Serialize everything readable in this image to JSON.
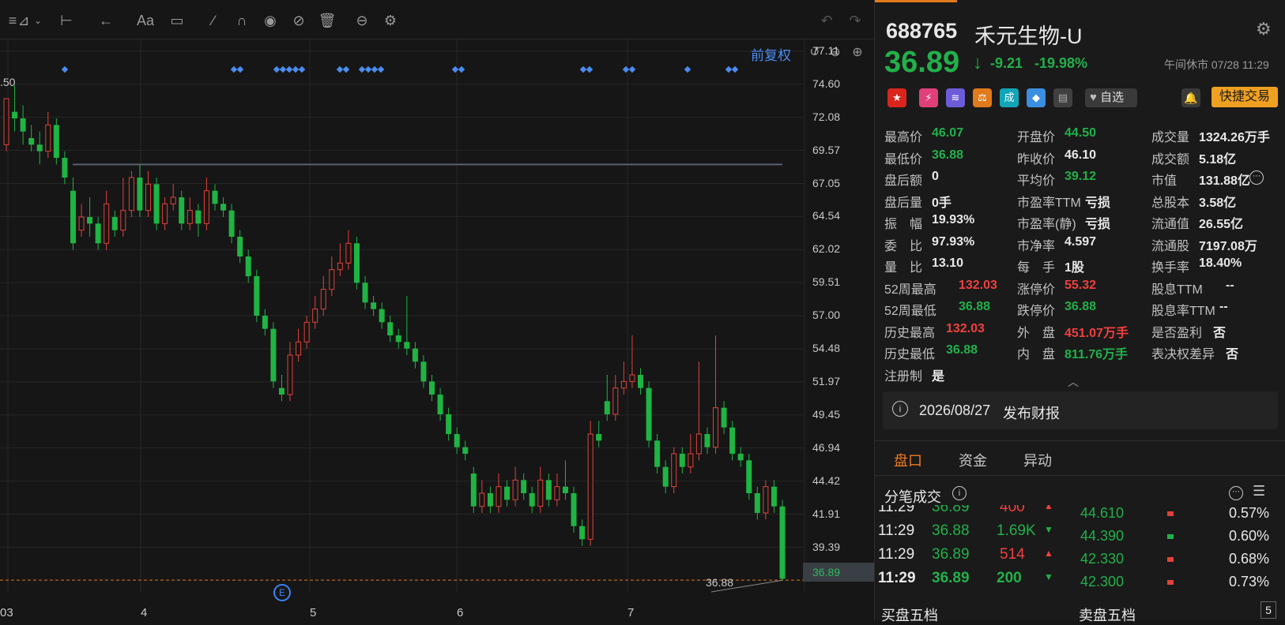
{
  "chart": {
    "adjust_label": "前复权",
    "top_left_partial": ".50",
    "y_labels": [
      "77.11",
      "74.60",
      "72.08",
      "69.57",
      "67.05",
      "64.54",
      "62.02",
      "59.51",
      "57.00",
      "54.48",
      "51.97",
      "49.45",
      "46.94",
      "44.42",
      "41.91",
      "39.39"
    ],
    "current_price_label": "36.89",
    "min_label": "36.88",
    "x_labels": [
      "03",
      "4",
      "5",
      "6",
      "7"
    ],
    "event_badge": "E"
  },
  "chart_data": {
    "type": "candlestick",
    "ylim": [
      36.0,
      78.0
    ],
    "reference_line": 68.5,
    "current_price": 36.89,
    "x_labels": [
      "03",
      "4",
      "5",
      "6",
      "7"
    ],
    "candles": [
      [
        70.0,
        73.5,
        70.5,
        69.5,
        "up"
      ],
      [
        72.5,
        72.0,
        74.5,
        71.0,
        "down"
      ],
      [
        72.0,
        71.0,
        73.0,
        70.0,
        "down"
      ],
      [
        70.5,
        70.0,
        71.5,
        69.5,
        "down"
      ],
      [
        70.0,
        69.5,
        71.0,
        68.5,
        "down"
      ],
      [
        69.5,
        71.5,
        72.5,
        69.0,
        "up"
      ],
      [
        71.5,
        69.0,
        72.0,
        68.5,
        "down"
      ],
      [
        69.0,
        67.5,
        69.5,
        67.0,
        "down"
      ],
      [
        66.5,
        62.5,
        67.5,
        62.0,
        "down"
      ],
      [
        63.5,
        64.5,
        65.5,
        63.0,
        "up"
      ],
      [
        64.5,
        64.0,
        66.0,
        63.0,
        "down"
      ],
      [
        64.0,
        62.5,
        64.5,
        62.0,
        "down"
      ],
      [
        62.5,
        65.5,
        66.5,
        62.0,
        "up"
      ],
      [
        64.5,
        63.5,
        65.0,
        63.0,
        "down"
      ],
      [
        63.5,
        65.0,
        67.5,
        63.0,
        "up"
      ],
      [
        65.0,
        67.5,
        68.0,
        64.5,
        "up"
      ],
      [
        67.5,
        65.0,
        68.5,
        64.5,
        "down"
      ],
      [
        65.0,
        67.0,
        68.0,
        64.5,
        "up"
      ],
      [
        67.0,
        64.0,
        67.5,
        63.5,
        "down"
      ],
      [
        64.0,
        65.5,
        66.0,
        63.5,
        "up"
      ],
      [
        65.5,
        66.0,
        67.0,
        65.0,
        "up"
      ],
      [
        66.0,
        64.0,
        66.5,
        63.5,
        "down"
      ],
      [
        64.0,
        65.0,
        66.0,
        63.5,
        "up"
      ],
      [
        65.0,
        64.0,
        65.5,
        63.0,
        "down"
      ],
      [
        64.0,
        66.5,
        67.5,
        63.5,
        "up"
      ],
      [
        66.5,
        65.5,
        67.0,
        65.0,
        "down"
      ],
      [
        65.5,
        65.0,
        66.0,
        64.5,
        "down"
      ],
      [
        65.0,
        63.0,
        65.5,
        62.5,
        "down"
      ],
      [
        63.0,
        61.5,
        63.5,
        61.0,
        "down"
      ],
      [
        61.5,
        60.0,
        62.0,
        59.5,
        "down"
      ],
      [
        60.0,
        57.0,
        60.5,
        56.5,
        "down"
      ],
      [
        57.0,
        56.0,
        57.5,
        55.5,
        "down"
      ],
      [
        56.0,
        52.0,
        56.5,
        51.5,
        "down"
      ],
      [
        51.5,
        51.0,
        52.5,
        50.5,
        "down"
      ],
      [
        51.0,
        54.0,
        55.0,
        50.5,
        "up"
      ],
      [
        54.0,
        55.0,
        56.0,
        53.5,
        "up"
      ],
      [
        55.0,
        56.5,
        57.0,
        54.5,
        "up"
      ],
      [
        56.5,
        57.5,
        58.5,
        56.0,
        "up"
      ],
      [
        57.5,
        59.0,
        60.0,
        57.0,
        "up"
      ],
      [
        59.0,
        60.5,
        61.5,
        58.5,
        "up"
      ],
      [
        60.5,
        61.0,
        62.5,
        60.0,
        "up"
      ],
      [
        61.0,
        62.5,
        63.5,
        60.5,
        "up"
      ],
      [
        62.5,
        59.5,
        63.0,
        59.0,
        "down"
      ],
      [
        59.5,
        58.0,
        60.0,
        57.5,
        "down"
      ],
      [
        58.0,
        57.5,
        58.5,
        57.0,
        "down"
      ],
      [
        57.5,
        56.5,
        58.0,
        56.0,
        "down"
      ],
      [
        56.5,
        55.5,
        57.0,
        55.0,
        "down"
      ],
      [
        55.5,
        55.0,
        56.0,
        54.5,
        "down"
      ],
      [
        55.0,
        54.5,
        58.5,
        54.0,
        "down"
      ],
      [
        54.5,
        53.5,
        55.0,
        53.0,
        "down"
      ],
      [
        53.5,
        52.0,
        54.0,
        51.5,
        "down"
      ],
      [
        52.0,
        51.0,
        52.5,
        50.5,
        "down"
      ],
      [
        51.0,
        49.5,
        51.5,
        49.0,
        "down"
      ],
      [
        49.5,
        48.0,
        50.0,
        47.5,
        "down"
      ],
      [
        48.0,
        47.0,
        48.5,
        46.5,
        "down"
      ],
      [
        47.0,
        46.5,
        47.5,
        46.0,
        "down"
      ],
      [
        45.0,
        42.5,
        45.5,
        42.0,
        "down"
      ],
      [
        42.5,
        43.5,
        44.5,
        42.0,
        "up"
      ],
      [
        43.5,
        42.5,
        44.0,
        42.0,
        "down"
      ],
      [
        42.5,
        44.0,
        45.0,
        42.0,
        "up"
      ],
      [
        44.0,
        43.0,
        44.5,
        42.5,
        "down"
      ],
      [
        43.0,
        44.5,
        45.5,
        42.5,
        "up"
      ],
      [
        44.5,
        43.5,
        45.0,
        43.0,
        "down"
      ],
      [
        43.5,
        42.5,
        44.0,
        42.0,
        "down"
      ],
      [
        42.5,
        44.5,
        45.5,
        42.0,
        "up"
      ],
      [
        44.5,
        43.0,
        45.0,
        42.5,
        "down"
      ],
      [
        43.0,
        44.0,
        45.0,
        42.5,
        "up"
      ],
      [
        44.0,
        43.5,
        46.0,
        43.0,
        "down"
      ],
      [
        43.5,
        41.0,
        44.0,
        40.5,
        "down"
      ],
      [
        41.0,
        40.0,
        41.5,
        39.5,
        "down"
      ],
      [
        40.0,
        48.0,
        49.0,
        39.5,
        "up"
      ],
      [
        48.0,
        47.5,
        49.0,
        47.0,
        "down"
      ],
      [
        50.5,
        49.5,
        52.5,
        49.0,
        "down"
      ],
      [
        49.5,
        51.5,
        52.5,
        49.0,
        "up"
      ],
      [
        51.5,
        52.0,
        53.5,
        51.0,
        "up"
      ],
      [
        52.0,
        52.5,
        55.5,
        51.5,
        "up"
      ],
      [
        52.5,
        51.5,
        53.0,
        51.0,
        "down"
      ],
      [
        51.5,
        47.5,
        52.0,
        47.0,
        "down"
      ],
      [
        47.5,
        45.5,
        48.0,
        45.0,
        "down"
      ],
      [
        45.5,
        44.0,
        46.0,
        43.5,
        "down"
      ],
      [
        44.0,
        46.5,
        47.0,
        43.5,
        "up"
      ],
      [
        46.5,
        45.5,
        47.0,
        45.0,
        "down"
      ],
      [
        45.5,
        46.5,
        48.0,
        45.0,
        "up"
      ],
      [
        46.5,
        48.0,
        53.5,
        46.0,
        "up"
      ],
      [
        48.0,
        47.0,
        48.5,
        46.5,
        "down"
      ],
      [
        47.0,
        50.0,
        55.5,
        46.5,
        "up"
      ],
      [
        50.0,
        48.5,
        50.5,
        48.0,
        "down"
      ],
      [
        48.5,
        46.5,
        49.0,
        46.0,
        "down"
      ],
      [
        46.5,
        46.0,
        47.0,
        45.5,
        "down"
      ],
      [
        46.0,
        43.5,
        46.5,
        43.0,
        "down"
      ],
      [
        43.5,
        42.0,
        44.0,
        41.5,
        "down"
      ],
      [
        42.0,
        44.0,
        44.5,
        41.5,
        "up"
      ],
      [
        44.0,
        42.5,
        44.5,
        42.0,
        "down"
      ],
      [
        42.5,
        37.0,
        43.0,
        36.88,
        "down"
      ]
    ]
  },
  "quote": {
    "code": "688765",
    "name": "禾元生物-U",
    "price": "36.89",
    "arrow": "↓",
    "change": "-9.21",
    "change_pct": "-19.98%",
    "status": "午间休市 07/28 11:29",
    "watch_label": "自选",
    "trade_label": "快捷交易",
    "tag_reg": "成"
  },
  "stats": [
    {
      "label": "最高价",
      "value": "46.07",
      "color": "#22b04a"
    },
    {
      "label": "开盘价",
      "value": "44.50",
      "color": "#22b04a"
    },
    {
      "label": "成交量",
      "value": "1324.26万手",
      "color": "#e8e8e8"
    },
    {
      "label": "最低价",
      "value": "36.88",
      "color": "#22b04a"
    },
    {
      "label": "昨收价",
      "value": "46.10",
      "color": "#e8e8e8"
    },
    {
      "label": "成交额",
      "value": "5.18亿",
      "color": "#e8e8e8"
    },
    {
      "label": "盘后额",
      "value": "0",
      "color": "#e8e8e8"
    },
    {
      "label": "平均价",
      "value": "39.12",
      "color": "#22b04a"
    },
    {
      "label": "市值",
      "value": "131.88亿",
      "color": "#e8e8e8"
    },
    {
      "label": "盘后量",
      "value": "0手",
      "color": "#e8e8e8"
    },
    {
      "label": "市盈率TTM",
      "value": "亏损",
      "color": "#e8e8e8"
    },
    {
      "label": "总股本",
      "value": "3.58亿",
      "color": "#e8e8e8"
    },
    {
      "label": "振　幅",
      "value": "19.93%",
      "color": "#e8e8e8"
    },
    {
      "label": "市盈率(静)",
      "value": "亏损",
      "color": "#e8e8e8"
    },
    {
      "label": "流通值",
      "value": "26.55亿",
      "color": "#e8e8e8"
    },
    {
      "label": "委　比",
      "value": "97.93%",
      "color": "#e8e8e8"
    },
    {
      "label": "市净率",
      "value": "4.597",
      "color": "#e8e8e8"
    },
    {
      "label": "流通股",
      "value": "7197.08万",
      "color": "#e8e8e8"
    },
    {
      "label": "量　比",
      "value": "13.10",
      "color": "#e8e8e8"
    },
    {
      "label": "每　手",
      "value": "1股",
      "color": "#e8e8e8"
    },
    {
      "label": "换手率",
      "value": "18.40%",
      "color": "#e8e8e8"
    },
    {
      "label": "52周最高",
      "value": "132.03",
      "color": "#f04040"
    },
    {
      "label": "涨停价",
      "value": "55.32",
      "color": "#f04040"
    },
    {
      "label": "股息TTM",
      "value": "--",
      "color": "#e8e8e8"
    },
    {
      "label": "52周最低",
      "value": "36.88",
      "color": "#22b04a"
    },
    {
      "label": "跌停价",
      "value": "36.88",
      "color": "#22b04a"
    },
    {
      "label": "股息率TTM",
      "value": "--",
      "color": "#e8e8e8"
    },
    {
      "label": "历史最高",
      "value": "132.03",
      "color": "#f04040"
    },
    {
      "label": "外　盘",
      "value": "451.07万手",
      "color": "#f04040"
    },
    {
      "label": "是否盈利",
      "value": "否",
      "color": "#e8e8e8"
    },
    {
      "label": "历史最低",
      "value": "36.88",
      "color": "#22b04a"
    },
    {
      "label": "内　盘",
      "value": "811.76万手",
      "color": "#22b04a"
    },
    {
      "label": "表决权差异",
      "value": "否",
      "color": "#e8e8e8"
    },
    {
      "label": "注册制",
      "value": "是",
      "color": "#e8e8e8"
    }
  ],
  "notice": {
    "date": "2026/08/27",
    "text": "发布财报"
  },
  "tabs": [
    {
      "label": "盘口",
      "active": true
    },
    {
      "label": "资金",
      "active": false
    },
    {
      "label": "异动",
      "active": false
    }
  ],
  "ticks_title": "分笔成交",
  "ticks": [
    {
      "time": "11:29",
      "price": "36.89",
      "vol": "400",
      "dir": "up"
    },
    {
      "time": "11:29",
      "price": "36.88",
      "vol": "1.69K",
      "dir": "down"
    },
    {
      "time": "11:29",
      "price": "36.89",
      "vol": "514",
      "dir": "up"
    },
    {
      "time": "11:29",
      "price": "36.89",
      "vol": "200",
      "dir": "down"
    }
  ],
  "orderbook": [
    {
      "price": "44.610",
      "pct": "0.57%"
    },
    {
      "price": "44.390",
      "pct": "0.60%"
    },
    {
      "price": "42.330",
      "pct": "0.68%"
    },
    {
      "price": "42.300",
      "pct": "0.73%"
    }
  ],
  "bottom": {
    "buy": "买盘五档",
    "sell": "卖盘五档",
    "num": "5"
  }
}
